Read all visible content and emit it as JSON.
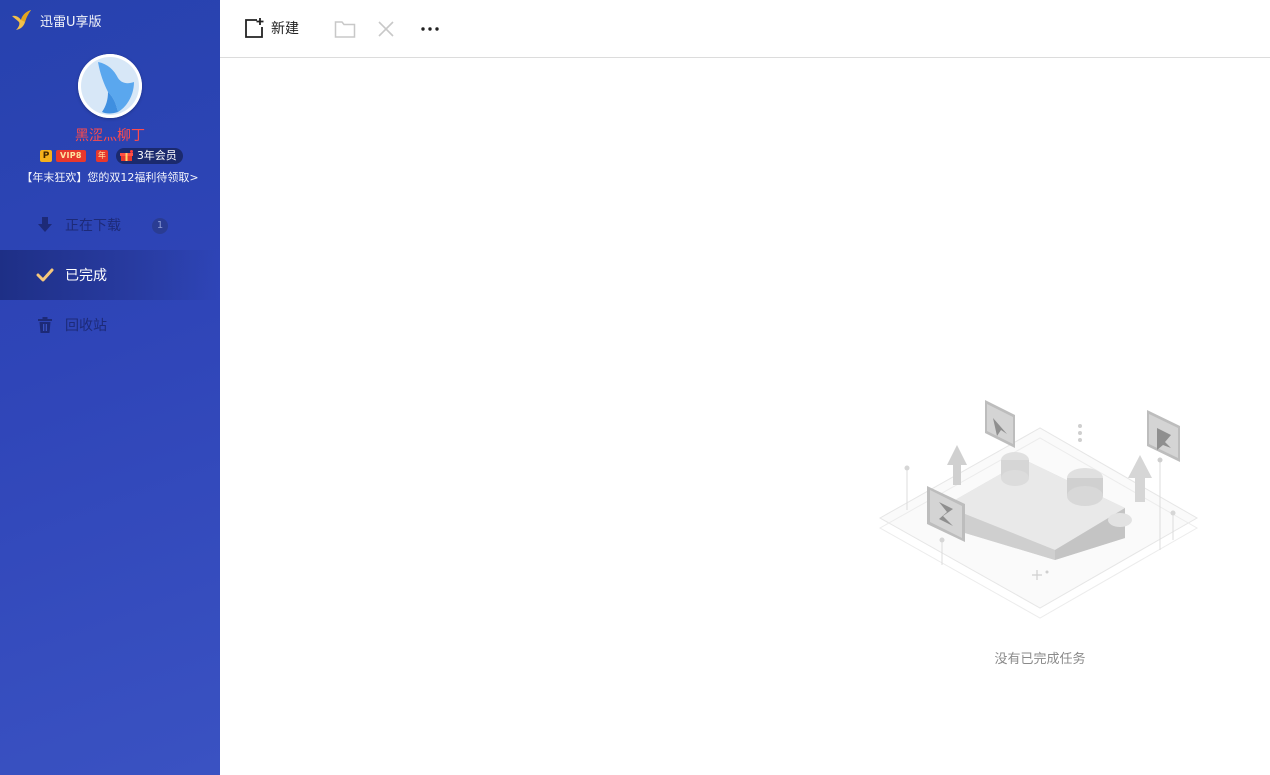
{
  "app": {
    "title": "迅雷U享版"
  },
  "user": {
    "name": "黑涩灬柳丁",
    "vip_label": "VIP8",
    "p_label": "P",
    "year_badge": "年",
    "membership": "3年会员",
    "promo": "【年末狂欢】您的双12福利待领取>"
  },
  "sidebar": {
    "items": [
      {
        "label": "正在下载",
        "icon": "download-arrow-icon",
        "count": "1",
        "active": false
      },
      {
        "label": "已完成",
        "icon": "checkmark-icon",
        "active": true
      },
      {
        "label": "回收站",
        "icon": "trash-icon",
        "active": false
      }
    ]
  },
  "toolbar": {
    "new_label": "新建",
    "icons": [
      "new-task-icon",
      "folder-icon",
      "close-icon",
      "more-icon"
    ]
  },
  "main": {
    "empty_text": "没有已完成任务"
  },
  "colors": {
    "sidebar_top": "#2742ae",
    "sidebar_bottom": "#3a52c2",
    "active_item": "#1e2f86",
    "username": "#ff4b4b",
    "inactive_text": "#1d2a78"
  }
}
